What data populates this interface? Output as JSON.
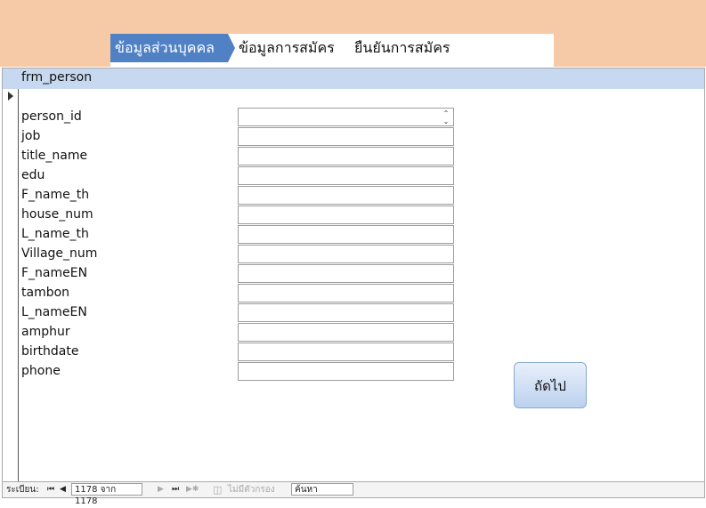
{
  "tabs": [
    {
      "label": "ข้อมูลส่วนบุคคล",
      "active": true
    },
    {
      "label": "ข้อมูลการสมัคร",
      "active": false
    },
    {
      "label": "ยืนยันการสมัคร",
      "active": false
    }
  ],
  "form": {
    "title": "frm_person",
    "fields": [
      {
        "label": "person_id",
        "value": ""
      },
      {
        "label": "job",
        "value": ""
      },
      {
        "label": "title_name",
        "value": ""
      },
      {
        "label": "edu",
        "value": ""
      },
      {
        "label": "F_name_th",
        "value": ""
      },
      {
        "label": "house_num",
        "value": ""
      },
      {
        "label": "L_name_th",
        "value": ""
      },
      {
        "label": "Village_num",
        "value": ""
      },
      {
        "label": "F_nameEN",
        "value": ""
      },
      {
        "label": "tambon",
        "value": ""
      },
      {
        "label": "L_nameEN",
        "value": ""
      },
      {
        "label": "amphur",
        "value": ""
      },
      {
        "label": "birthdate",
        "value": ""
      },
      {
        "label": "phone",
        "value": ""
      }
    ],
    "next_button": "ถัดไป"
  },
  "navigation": {
    "record_label": "ระเบียน:",
    "first_icon": "first-record-icon",
    "prev_icon": "previous-record-icon",
    "record_position": "1178 จาก 1178",
    "next_icon": "next-record-icon",
    "last_icon": "last-record-icon",
    "new_icon": "new-record-icon",
    "filter_icon": "no-filter-icon",
    "filter_label": "ไม่มีตัวกรอง",
    "search_placeholder": "ค้นหา"
  },
  "colors": {
    "top_band": "#f6caa6",
    "active_tab": "#4f81c4",
    "form_header": "#c6d9f1"
  }
}
